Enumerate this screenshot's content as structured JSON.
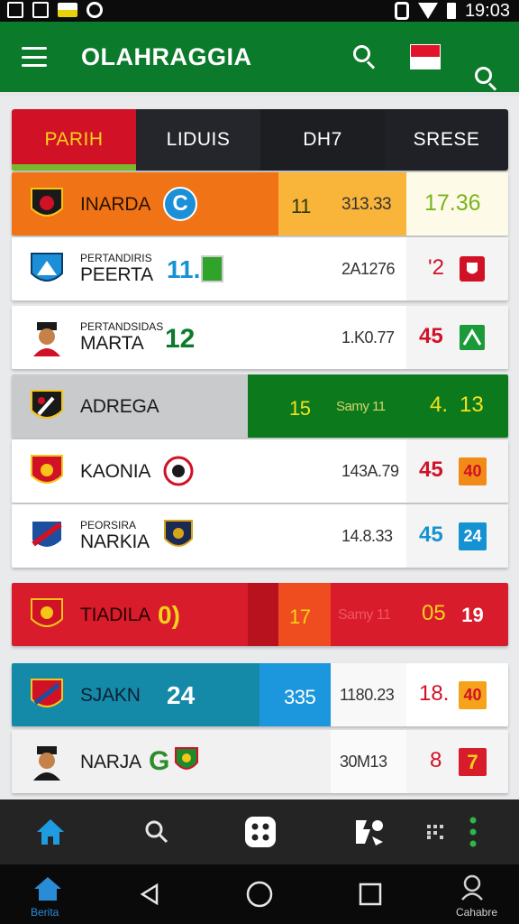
{
  "status_bar": {
    "time": "19:03",
    "icons": [
      "notification-icon",
      "image-icon",
      "flag-notification-icon",
      "circle-icon",
      "vibrate-icon",
      "wifi-icon",
      "battery-icon"
    ]
  },
  "app_bar": {
    "title": "OLAHRAGGIA",
    "icons": [
      "menu-icon",
      "search-icon",
      "indonesia-flag-icon",
      "search-icon"
    ]
  },
  "tabs": [
    {
      "label": "PARIH"
    },
    {
      "label": "LIDUIS"
    },
    {
      "label": "DH7"
    },
    {
      "label": "SRESE"
    }
  ],
  "rows": [
    {
      "team": "INARDA",
      "badge": "C",
      "score": "11",
      "value": "313.33",
      "result": "17.36"
    },
    {
      "team_small": "PERTANDIRIS",
      "team": "PEERTA",
      "score": "11.",
      "value": "2A1276",
      "result": "'2"
    },
    {
      "team_small": "PERTANDSIDAS",
      "team": "MARTA",
      "score": "12",
      "value": "1.K0.77",
      "result": "45"
    },
    {
      "team": "ADREGA",
      "score": "15",
      "value": "Samy 11",
      "result": "4.",
      "result2": "13"
    },
    {
      "team": "KAONIA",
      "value": "143A.79",
      "result": "45",
      "box": "40"
    },
    {
      "team_small": "PEORSIRA",
      "team": "NARKIA",
      "value": "14.8.33",
      "result": "45",
      "box": "24"
    },
    {
      "team": "TIADILA",
      "score": "0)",
      "num2": "17",
      "value": "Samy 11",
      "result": "05",
      "box": "19"
    },
    {
      "team": "SJAKN",
      "score": "24",
      "num2": "335",
      "value": "1180.23",
      "result": "18.",
      "box": "40"
    },
    {
      "team": "NARJA",
      "badge": "G",
      "value": "30M13",
      "result": "8",
      "box": "7"
    }
  ],
  "bottom_tabs": [
    "home-icon",
    "search-icon",
    "dice-icon",
    "puzzle-icon",
    "dots-icon",
    "more-icon"
  ],
  "nav": {
    "home_label": "Berita",
    "profile_label": "Cahabre"
  },
  "colors": {
    "green": "#0b7a2b",
    "red": "#d11126",
    "orange": "#f07416",
    "teal": "#148aa8",
    "blue": "#1592d2"
  }
}
